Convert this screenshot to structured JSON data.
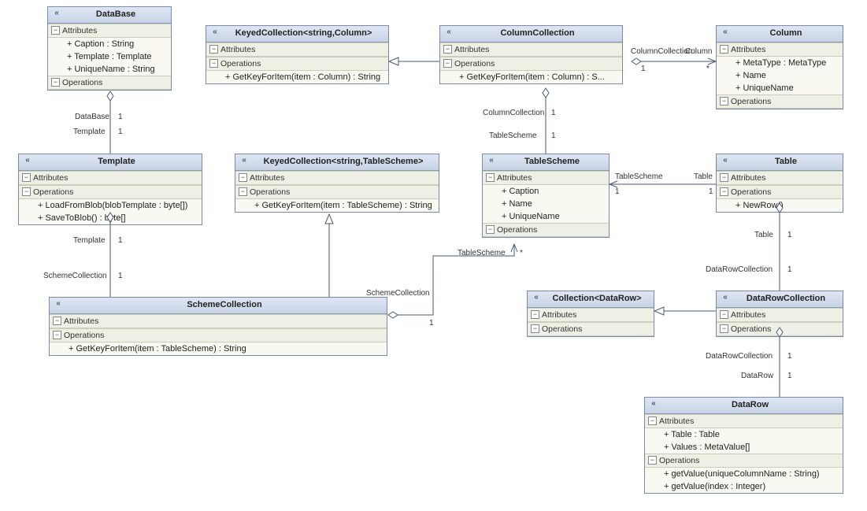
{
  "classes": {
    "database": {
      "title": "DataBase",
      "attrs_label": "Attributes",
      "ops_label": "Operations",
      "attrs": [
        "+ Caption : String",
        "+ Template : Template",
        "+ UniqueName : String"
      ]
    },
    "keyed_col_column": {
      "title": "KeyedCollection<string,Column>",
      "attrs_label": "Attributes",
      "ops_label": "Operations",
      "ops": [
        "+ GetKeyForItem(item : Column) : String"
      ]
    },
    "column_collection": {
      "title": "ColumnCollection",
      "attrs_label": "Attributes",
      "ops_label": "Operations",
      "ops": [
        "+ GetKeyForItem(item : Column) : S..."
      ]
    },
    "column": {
      "title": "Column",
      "attrs_label": "Attributes",
      "ops_label": "Operations",
      "attrs": [
        "+ MetaType : MetaType",
        "+ Name",
        "+ UniqueName"
      ]
    },
    "template": {
      "title": "Template",
      "attrs_label": "Attributes",
      "ops_label": "Operations",
      "ops": [
        "+ LoadFromBlob(blobTemplate : byte[])",
        "+ SaveToBlob() : byte[]"
      ]
    },
    "keyed_col_tablescheme": {
      "title": "KeyedCollection<string,TableScheme>",
      "attrs_label": "Attributes",
      "ops_label": "Operations",
      "ops": [
        "+ GetKeyForItem(item : TableScheme) : String"
      ]
    },
    "tablescheme": {
      "title": "TableScheme",
      "attrs_label": "Attributes",
      "ops_label": "Operations",
      "attrs": [
        "+ Caption",
        "+ Name",
        "+ UniqueName"
      ]
    },
    "table": {
      "title": "Table",
      "attrs_label": "Attributes",
      "ops_label": "Operations",
      "ops": [
        "+ NewRow()"
      ]
    },
    "scheme_collection": {
      "title": "SchemeCollection",
      "attrs_label": "Attributes",
      "ops_label": "Operations",
      "ops": [
        "+ GetKeyForItem(item : TableScheme) : String"
      ]
    },
    "collection_datarow": {
      "title": "Collection<DataRow>",
      "attrs_label": "Attributes",
      "ops_label": "Operations"
    },
    "datarow_collection": {
      "title": "DataRowCollection",
      "attrs_label": "Attributes",
      "ops_label": "Operations"
    },
    "datarow": {
      "title": "DataRow",
      "attrs_label": "Attributes",
      "ops_label": "Operations",
      "attrs": [
        "+ Table : Table",
        "+ Values : MetaValue[]"
      ],
      "ops": [
        "+ getValue(uniqueColumnName : String)",
        "+ getValue(index : Integer)"
      ]
    }
  },
  "labels": {
    "db_tpl_database": "DataBase",
    "db_tpl_1a": "1",
    "db_tpl_template": "Template",
    "db_tpl_1b": "1",
    "tpl_sc_template": "Template",
    "tpl_sc_1a": "1",
    "tpl_sc_scheme": "SchemeCollection",
    "tpl_sc_1b": "1",
    "cc_col_cc": "ColumnCollection",
    "cc_col_1": "1",
    "cc_col_col": "Column",
    "cc_col_star": "*",
    "ts_cc_cc": "ColumnCollection",
    "ts_cc_1a": "1",
    "ts_cc_ts": "TableScheme",
    "ts_cc_1b": "1",
    "sc_ts_sc": "SchemeCollection",
    "sc_ts_1": "1",
    "sc_ts_ts": "TableScheme",
    "sc_ts_star": "*",
    "ts_tbl_ts": "TableScheme",
    "ts_tbl_1a": "1",
    "ts_tbl_tbl": "Table",
    "ts_tbl_1b": "1",
    "tbl_drc_tbl": "Table",
    "tbl_drc_1a": "1",
    "tbl_drc_drc": "DataRowCollection",
    "tbl_drc_1b": "1",
    "drc_dr_drc": "DataRowCollection",
    "drc_dr_1a": "1",
    "drc_dr_dr": "DataRow",
    "drc_dr_1b": "1"
  }
}
